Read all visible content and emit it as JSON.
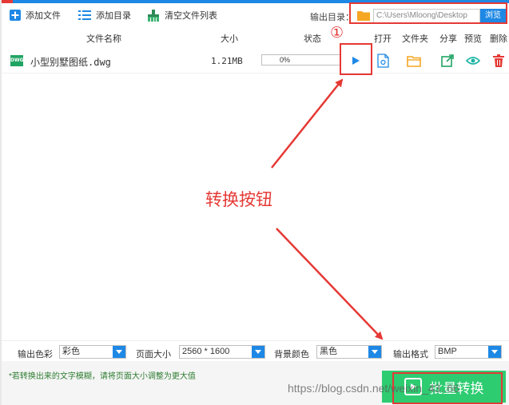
{
  "toolbar": {
    "add_file": "添加文件",
    "add_folder": "添加目录",
    "clear_list": "清空文件列表",
    "output_dir_label": "输出目录：",
    "output_dir_value": "C:\\Users\\Mloong\\Desktop",
    "browse": "浏览"
  },
  "table": {
    "headers": {
      "file_name": "文件名称",
      "size": "大小",
      "status": "状态",
      "open": "打开",
      "folder": "文件夹",
      "share": "分享",
      "preview": "预览",
      "delete": "删除"
    },
    "rows": [
      {
        "name": "小型别墅图纸.dwg",
        "icon_text": "DWG",
        "size": "1.21MB",
        "progress_label": "0%",
        "progress": 0.0
      }
    ]
  },
  "annotation": {
    "marker": "①",
    "text": "转换按钮"
  },
  "options": {
    "color_label": "输出色彩",
    "color_value": "彩色",
    "page_size_label": "页面大小",
    "page_size_value": "2560 * 1600",
    "bg_color_label": "背景颜色",
    "bg_color_value": "黑色",
    "format_label": "输出格式",
    "format_value": "BMP"
  },
  "footer": {
    "tip": "*若转换出来的文字模糊，请将页面大小调整为更大值",
    "convert_button": "批量转换",
    "watermark": "https://blog.csdn.net/weixin_43..66"
  },
  "colors": {
    "accent_blue": "#1e88e5",
    "convert_green": "#2ecc71",
    "annotation_red": "#e53935",
    "file_icon_green": "#20a464"
  }
}
